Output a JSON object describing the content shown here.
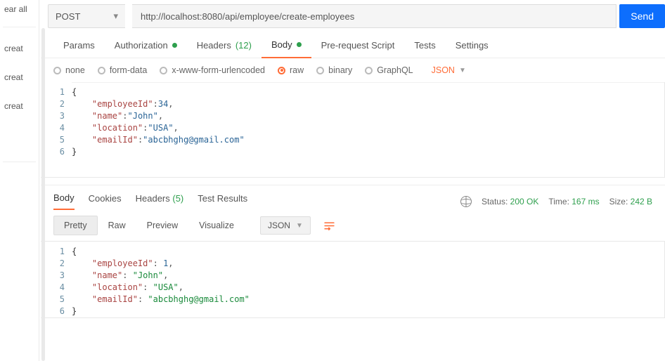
{
  "leftRail": {
    "top": "ear all",
    "items": [
      "creat",
      "creat",
      "creat"
    ]
  },
  "request": {
    "method": "POST",
    "url": "http://localhost:8080/api/employee/create-employees",
    "send": "Send"
  },
  "reqTabs": {
    "params": "Params",
    "auth": "Authorization",
    "headers": "Headers",
    "headers_count": "(12)",
    "body": "Body",
    "prereq": "Pre-request Script",
    "tests": "Tests",
    "settings": "Settings"
  },
  "bodyOptions": {
    "none": "none",
    "formdata": "form-data",
    "xwww": "x-www-form-urlencoded",
    "raw": "raw",
    "binary": "binary",
    "graphql": "GraphQL",
    "subtype": "JSON"
  },
  "reqBody": {
    "lines": [
      "1",
      "2",
      "3",
      "4",
      "5",
      "6"
    ],
    "json": {
      "employeeId": 34,
      "name": "John",
      "location": "USA",
      "emailId": "abcbhghg@gmail.com"
    }
  },
  "respTabs": {
    "body": "Body",
    "cookies": "Cookies",
    "headers": "Headers",
    "headers_count": "(5)",
    "tests": "Test Results"
  },
  "status": {
    "label": "Status:",
    "code": "200 OK",
    "time_label": "Time:",
    "time": "167 ms",
    "size_label": "Size:",
    "size": "242 B"
  },
  "viewModes": {
    "pretty": "Pretty",
    "raw": "Raw",
    "preview": "Preview",
    "visualize": "Visualize",
    "type": "JSON"
  },
  "respBody": {
    "lines": [
      "1",
      "2",
      "3",
      "4",
      "5",
      "6"
    ],
    "json": {
      "employeeId": 1,
      "name": "John",
      "location": "USA",
      "emailId": "abcbhghg@gmail.com"
    }
  }
}
